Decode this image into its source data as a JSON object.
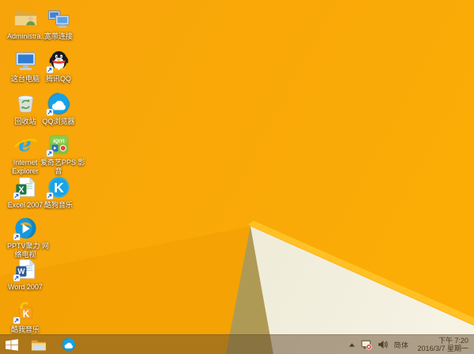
{
  "wallpaper": {
    "colors": {
      "base": "#F7A40B",
      "base_bright": "#FBAC05",
      "facet_shadow": "#F09C02",
      "tan_facet": "#AF9A55",
      "cream_facet": "#F3EFDE",
      "cream_facet_light": "#F6F2E4",
      "highlight_edge": "#FFC125",
      "taskbar_overlay": "rgba(100,75,45,0.5)"
    }
  },
  "desktop": {
    "icons": [
      {
        "id": "administrator-folder",
        "icon": "user-folder",
        "label": "Administra...",
        "shortcut": false,
        "col": 1,
        "row": 1
      },
      {
        "id": "broadband-connection",
        "icon": "broadband",
        "label": "宽带连接",
        "shortcut": false,
        "col": 2,
        "row": 1
      },
      {
        "id": "this-pc",
        "icon": "this-pc",
        "label": "这台电脑",
        "shortcut": false,
        "col": 1,
        "row": 2
      },
      {
        "id": "tencent-qq",
        "icon": "qq",
        "label": "腾讯QQ",
        "shortcut": true,
        "col": 2,
        "row": 2
      },
      {
        "id": "recycle-bin",
        "icon": "recycle-bin",
        "label": "回收站",
        "shortcut": false,
        "col": 1,
        "row": 3
      },
      {
        "id": "qq-browser",
        "icon": "qq-browser",
        "label": "QQ浏览器",
        "shortcut": true,
        "col": 2,
        "row": 3
      },
      {
        "id": "internet-explorer",
        "icon": "ie",
        "label": "Internet Explorer",
        "lines": [
          "Internet",
          "Explorer"
        ],
        "shortcut": false,
        "col": 1,
        "row": 4
      },
      {
        "id": "iqiyi-pps",
        "icon": "pps",
        "label": "爱奇艺PPS 影音",
        "lines": [
          "爱奇艺PPS 影",
          "音"
        ],
        "shortcut": true,
        "col": 2,
        "row": 4
      },
      {
        "id": "excel-2007",
        "icon": "excel",
        "label": "Excel 2007",
        "shortcut": true,
        "col": 1,
        "row": 5
      },
      {
        "id": "kugou-music",
        "icon": "kugou",
        "label": "酷狗音乐",
        "shortcut": true,
        "col": 2,
        "row": 5
      },
      {
        "id": "pptv",
        "icon": "pptv",
        "label": "PPTV聚力 网络电视",
        "lines": [
          "PPTV聚力 网",
          "络电视"
        ],
        "shortcut": true,
        "col": 1,
        "row": 6
      },
      {
        "id": "word-2007",
        "icon": "word",
        "label": "Word 2007",
        "shortcut": true,
        "col": 1,
        "row": 7
      },
      {
        "id": "kuwo-music",
        "icon": "kuwo",
        "label": "酷我音乐",
        "shortcut": true,
        "col": 1,
        "row": 8
      }
    ]
  },
  "taskbar": {
    "buttons": [
      {
        "id": "start",
        "icon": "windows-logo"
      },
      {
        "id": "file-explorer",
        "icon": "file-explorer"
      },
      {
        "id": "qq-browser",
        "icon": "qq-browser"
      }
    ],
    "tray": {
      "input_method": "简体",
      "time": "下午 7:20",
      "date": "2016/3/7 星期一"
    }
  }
}
